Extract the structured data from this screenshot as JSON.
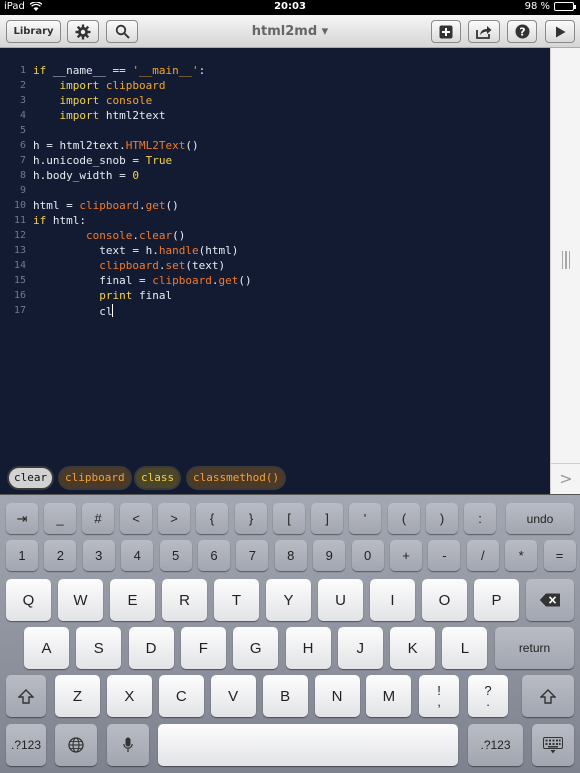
{
  "status": {
    "device": "iPad",
    "time": "20:03",
    "battery": "98 %"
  },
  "toolbar": {
    "library": "Library",
    "title": "html2md ▾"
  },
  "editor": {
    "lines": [
      [
        [
          "kw",
          "if"
        ],
        [
          "p",
          " __name__ == "
        ],
        [
          "str",
          "'__main__'"
        ],
        [
          "p",
          ":"
        ]
      ],
      [
        [
          "p",
          "    "
        ],
        [
          "kw",
          "import"
        ],
        [
          "str",
          " clipboard"
        ]
      ],
      [
        [
          "p",
          "    "
        ],
        [
          "kw",
          "import"
        ],
        [
          "str",
          " console"
        ]
      ],
      [
        [
          "p",
          "    "
        ],
        [
          "kw",
          "import"
        ],
        [
          "p",
          " html2text"
        ]
      ],
      [],
      [
        [
          "p",
          "h = html2text."
        ],
        [
          "fn",
          "HTML2Text"
        ],
        [
          "p",
          "()"
        ]
      ],
      [
        [
          "p",
          "h.unicode_snob = "
        ],
        [
          "kw",
          "True"
        ]
      ],
      [
        [
          "p",
          "h.body_width = "
        ],
        [
          "kw",
          "0"
        ]
      ],
      [],
      [
        [
          "p",
          "html = "
        ],
        [
          "fn",
          "clipboard"
        ],
        [
          "p",
          "."
        ],
        [
          "fn",
          "get"
        ],
        [
          "p",
          "()"
        ]
      ],
      [
        [
          "kw",
          "if"
        ],
        [
          "p",
          " html:"
        ]
      ],
      [
        [
          "p",
          "        "
        ],
        [
          "fn",
          "console"
        ],
        [
          "p",
          "."
        ],
        [
          "fn",
          "clear"
        ],
        [
          "p",
          "()"
        ]
      ],
      [
        [
          "p",
          "          text = h."
        ],
        [
          "fn",
          "handle"
        ],
        [
          "p",
          "(html)"
        ]
      ],
      [
        [
          "p",
          "          "
        ],
        [
          "fn",
          "clipboard"
        ],
        [
          "p",
          "."
        ],
        [
          "fn",
          "set"
        ],
        [
          "p",
          "(text)"
        ]
      ],
      [
        [
          "p",
          "          final = "
        ],
        [
          "fn",
          "clipboard"
        ],
        [
          "p",
          "."
        ],
        [
          "fn",
          "get"
        ],
        [
          "p",
          "()"
        ]
      ],
      [
        [
          "p",
          "          "
        ],
        [
          "kw",
          "print"
        ],
        [
          "p",
          " final"
        ]
      ],
      [
        [
          "p",
          "          cl"
        ]
      ]
    ]
  },
  "completions": [
    "clear",
    "clipboard",
    "class",
    "classmethod()"
  ],
  "keyboard": {
    "row1": [
      "⇥",
      "_",
      "#",
      "<",
      ">",
      "{",
      "}",
      "[",
      "]",
      "'",
      "(",
      ")",
      ":",
      "undo"
    ],
    "row2": [
      "1",
      "2",
      "3",
      "4",
      "5",
      "6",
      "7",
      "8",
      "9",
      "0",
      "+",
      "-",
      "/",
      "*",
      "="
    ],
    "row3": [
      "Q",
      "W",
      "E",
      "R",
      "T",
      "Y",
      "U",
      "I",
      "O",
      "P"
    ],
    "row4": [
      "A",
      "S",
      "D",
      "F",
      "G",
      "H",
      "J",
      "K",
      "L"
    ],
    "row5": [
      "Z",
      "X",
      "C",
      "V",
      "B",
      "N",
      "M"
    ],
    "return": "return",
    "excl": [
      "!",
      ","
    ],
    "quest": [
      "?",
      "."
    ],
    "num": ".?123"
  }
}
